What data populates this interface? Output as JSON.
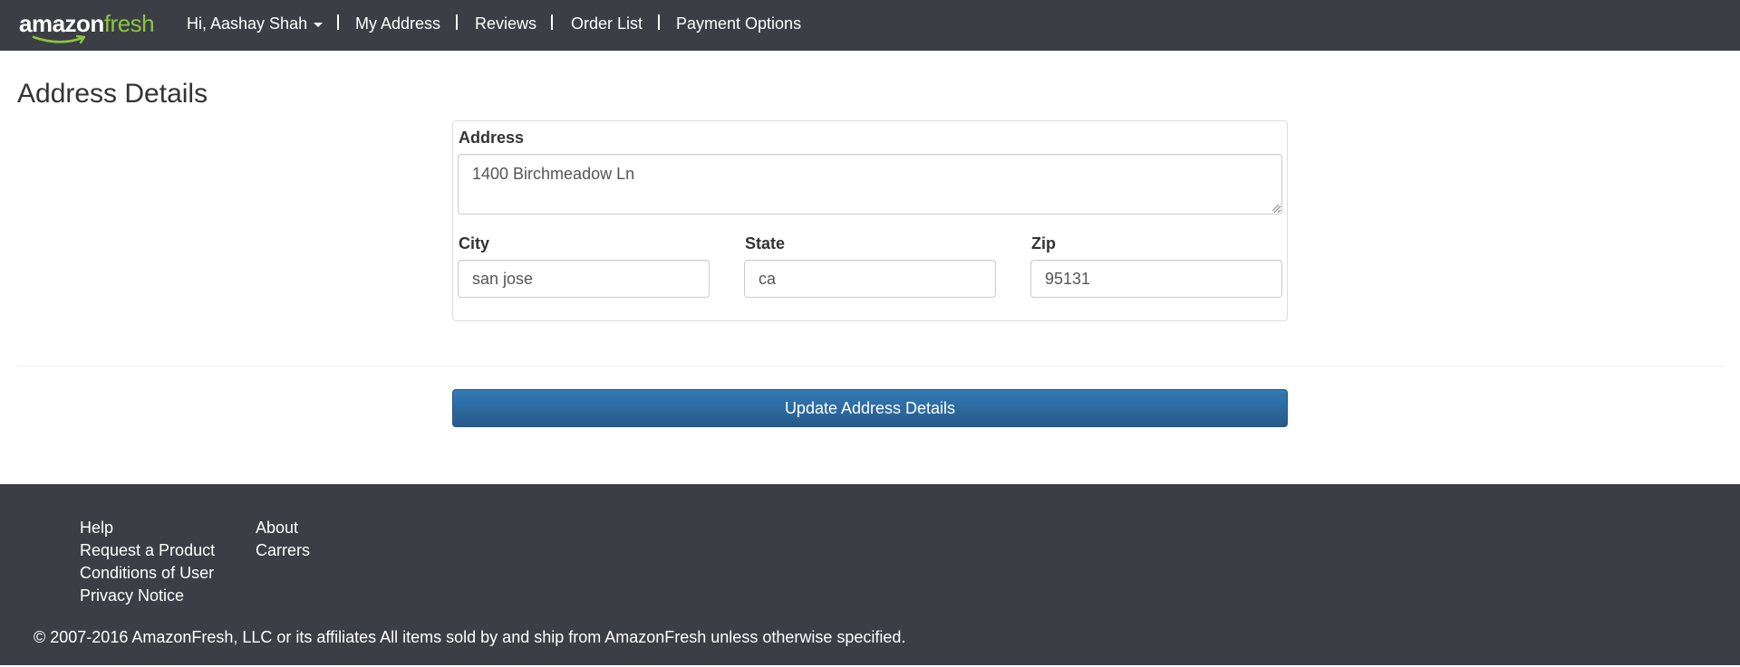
{
  "app": {
    "logo": {
      "part1": "amazon",
      "part2": "fresh",
      "logo_accent": "#8cc63f"
    },
    "colors": {
      "nav_bg": "#3b3e45",
      "button_primary": "#337ab7",
      "footer_bg": "#3b3e45"
    }
  },
  "navbar": {
    "user_menu_label": "Hi, Aashay Shah",
    "user_menu_icon": "caret-down-icon",
    "links": [
      "My Address",
      "Reviews",
      "Order List",
      "Payment Options"
    ]
  },
  "page": {
    "title": "Address Details"
  },
  "form": {
    "address": {
      "label": "Address",
      "value": "1400 Birchmeadow Ln"
    },
    "city": {
      "label": "City",
      "value": "san jose"
    },
    "state": {
      "label": "State",
      "value": "ca"
    },
    "zip": {
      "label": "Zip",
      "value": "95131"
    },
    "submit_label": "Update Address Details"
  },
  "footer": {
    "col1": [
      "Help",
      "Request a Product",
      "Conditions of User",
      "Privacy Notice"
    ],
    "col2": [
      "About",
      "Carrers"
    ],
    "copyright": "© 2007-2016 AmazonFresh, LLC or its affiliates All items sold by and ship from AmazonFresh unless otherwise specified."
  }
}
